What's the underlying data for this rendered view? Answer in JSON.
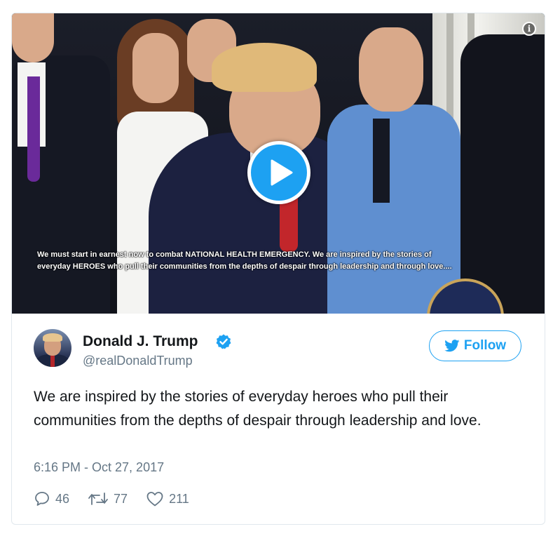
{
  "video": {
    "subtitle_line1": "We must start in earnest now to combat NATIONAL HEALTH EMERGENCY. We are inspired by the stories of",
    "subtitle_line2": "everyday HEROES who pull their communities from the depths of despair through leadership and through love....",
    "info_icon": "i"
  },
  "tweet": {
    "display_name": "Donald J. Trump",
    "handle": "@realDonaldTrump",
    "follow_label": "Follow",
    "text": "We are inspired by the stories of everyday heroes who pull their communities from the depths of despair through leadership and love.",
    "timestamp": "6:16 PM - Oct 27, 2017",
    "replies": "46",
    "retweets": "77",
    "likes": "211"
  },
  "colors": {
    "accent": "#1da1f2",
    "muted": "#657786",
    "text": "#14171a",
    "border": "#e1e8ed"
  },
  "icons": {
    "play": "play-icon",
    "verified": "verified-badge-icon",
    "bird": "twitter-bird-icon",
    "reply": "reply-icon",
    "retweet": "retweet-icon",
    "like": "heart-icon",
    "info": "info-icon"
  }
}
